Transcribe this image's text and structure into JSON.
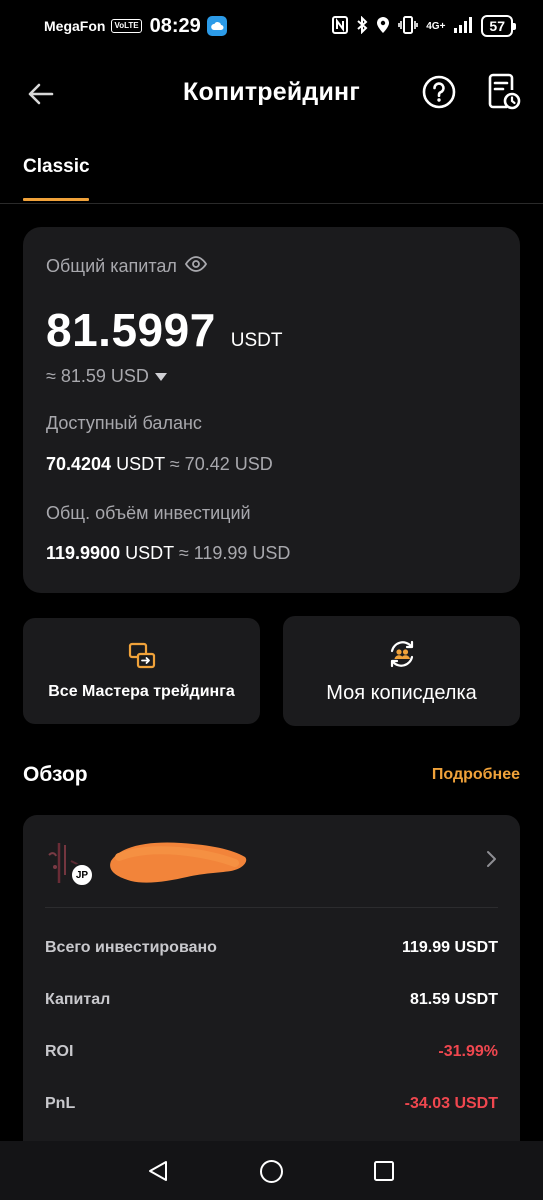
{
  "status_bar": {
    "carrier": "MegaFon",
    "volte": "VoLTE",
    "time": "08:29",
    "network": "4G+",
    "battery": "57"
  },
  "header": {
    "title": "Копитрейдинг"
  },
  "tabs": [
    {
      "label": "Classic",
      "active": true
    }
  ],
  "assets": {
    "total_capital_label": "Общий капитал",
    "total_capital_value": "81.5997",
    "total_capital_unit": "USDT",
    "total_capital_usd": "≈ 81.59 USD",
    "available_label": "Доступный баланс",
    "available_value": "70.4204",
    "available_unit": "USDT",
    "available_usd": "≈ 70.42 USD",
    "investment_label": "Общ. объём инвестиций",
    "investment_value": "119.9900",
    "investment_unit": "USDT",
    "investment_usd": "≈ 119.99 USD"
  },
  "actions": {
    "all_masters": "Все Мастера трейдинга",
    "my_copytrade": "Моя кописделка"
  },
  "overview": {
    "title": "Обзор",
    "more": "Подробнее",
    "trader_badge": "JP",
    "stats": [
      {
        "label": "Всего инвестировано",
        "value": "119.99 USDT",
        "negative": false
      },
      {
        "label": "Капитал",
        "value": "81.59 USDT",
        "negative": false
      },
      {
        "label": "ROI",
        "value": "-31.99%",
        "negative": true
      },
      {
        "label": "PnL",
        "value": "-34.03 USDT",
        "negative": true
      }
    ]
  },
  "colors": {
    "accent": "#f0a23a",
    "negative": "#f0474f",
    "card": "#1b1b1d",
    "background": "#000000"
  }
}
